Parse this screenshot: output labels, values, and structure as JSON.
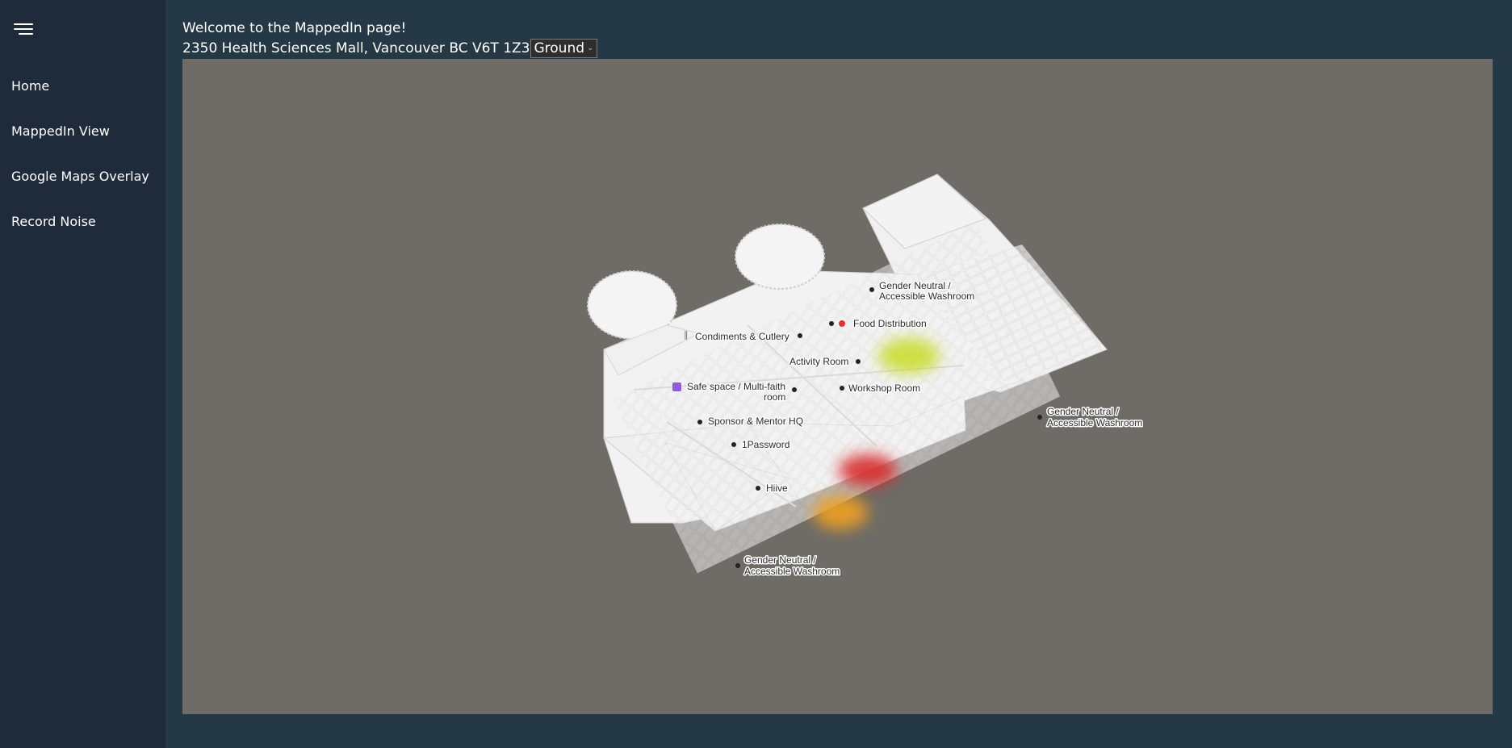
{
  "sidebar": {
    "menu_icon": "hamburger-icon",
    "items": [
      {
        "label": "Home"
      },
      {
        "label": "MappedIn View"
      },
      {
        "label": "Google Maps Overlay"
      },
      {
        "label": "Record Noise"
      }
    ]
  },
  "header": {
    "welcome": "Welcome to the MappedIn page!",
    "address": "2350 Health Sciences Mall, Vancouver BC V6T 1Z3",
    "floor_selected": "Ground"
  },
  "map": {
    "labels": [
      {
        "id": "gn1a",
        "text": "Gender Neutral /"
      },
      {
        "id": "gn1b",
        "text": "Accessible Washroom"
      },
      {
        "id": "food",
        "text": "Food Distribution"
      },
      {
        "id": "cond",
        "text": "Condiments & Cutlery"
      },
      {
        "id": "activity",
        "text": "Activity Room"
      },
      {
        "id": "safe1",
        "text": "Safe space / Multi-faith"
      },
      {
        "id": "safe2",
        "text": "room"
      },
      {
        "id": "workshop",
        "text": "Workshop Room"
      },
      {
        "id": "gn2a",
        "text": "Gender Neutral /"
      },
      {
        "id": "gn2b",
        "text": "Accessible Washroom"
      },
      {
        "id": "sponsor",
        "text": "Sponsor & Mentor HQ"
      },
      {
        "id": "onepass",
        "text": "1Password"
      },
      {
        "id": "hiive",
        "text": "Hiive"
      },
      {
        "id": "gn3a",
        "text": "Gender Neutral /"
      },
      {
        "id": "gn3b",
        "text": "Accessible Washroom"
      }
    ],
    "heat_colors": {
      "low": "#c8dc28",
      "medium": "#f0a020",
      "high": "#d82a2a"
    }
  },
  "colors": {
    "page_bg": "#243845",
    "sidebar_bg": "#1f2a3b",
    "map_bg": "#6f6b66",
    "floor": "#f1f1f1"
  }
}
